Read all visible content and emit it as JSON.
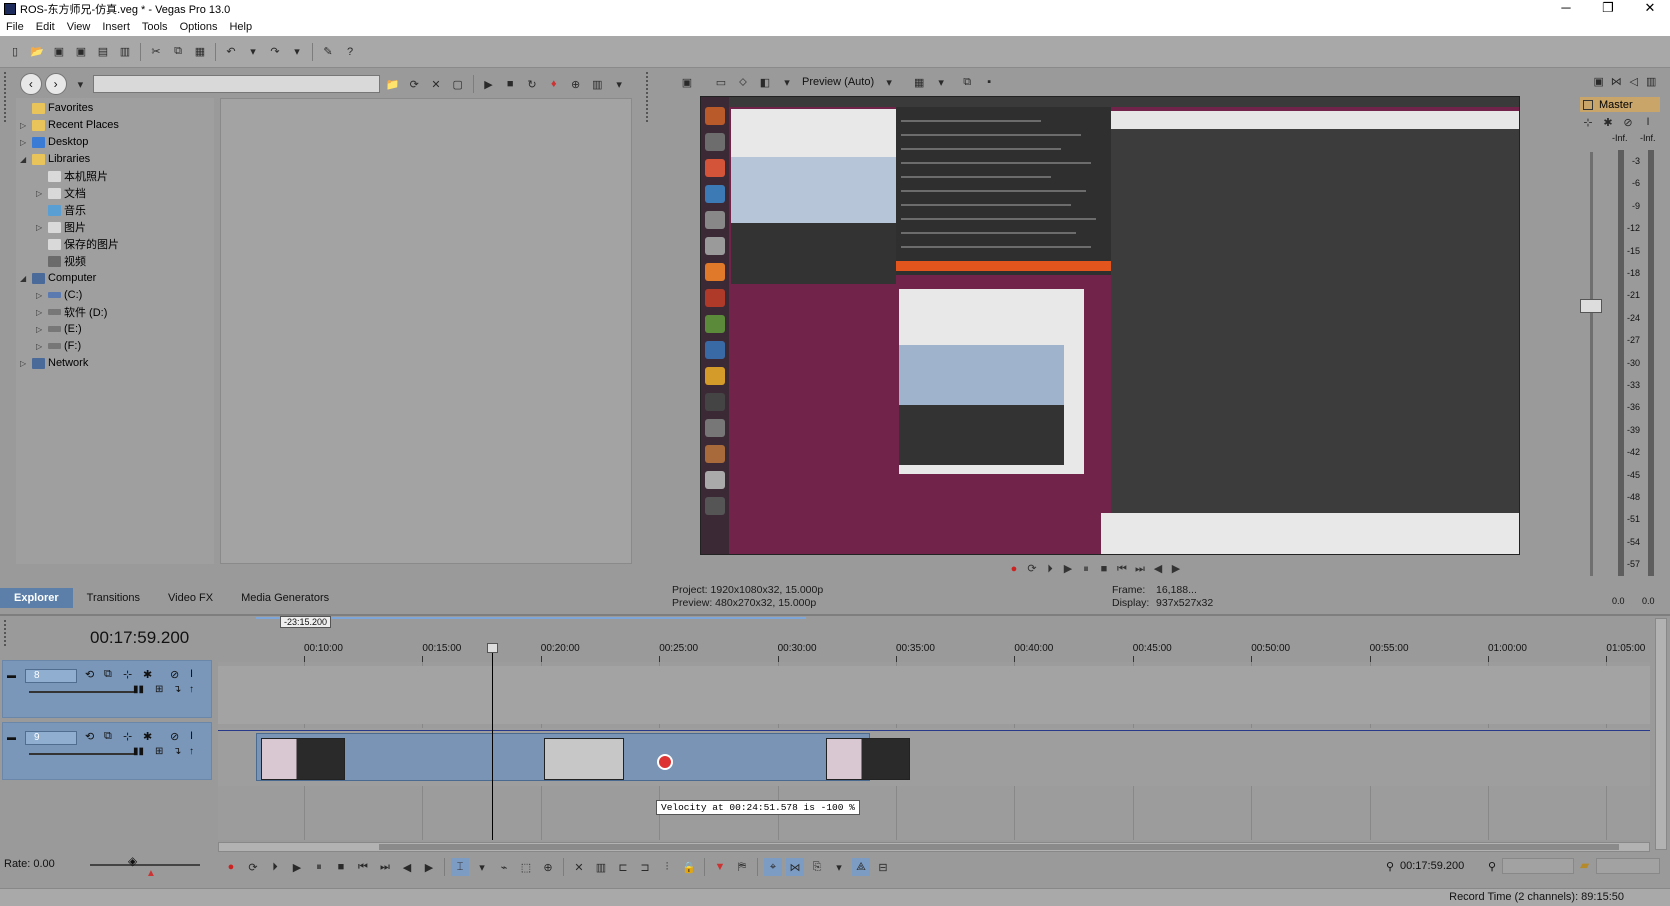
{
  "window": {
    "title": "ROS-东方师兄-仿真.veg * - Vegas Pro 13.0",
    "minimize": "─",
    "restore": "❐",
    "close": "✕"
  },
  "menu": [
    "File",
    "Edit",
    "View",
    "Insert",
    "Tools",
    "Options",
    "Help"
  ],
  "explorer": {
    "tree": [
      {
        "label": "Favorites",
        "expander": "",
        "icon_color": "#e8c45a"
      },
      {
        "label": "Recent Places",
        "expander": "▷",
        "icon_color": "#e8c45a"
      },
      {
        "label": "Desktop",
        "expander": "▷",
        "icon_color": "#3a7bd5"
      },
      {
        "label": "Libraries",
        "expander": "◢",
        "icon_color": "#e8c45a"
      },
      {
        "label": "本机照片",
        "expander": "",
        "icon_color": "#d9d9d9"
      },
      {
        "label": "文档",
        "expander": "▷",
        "icon_color": "#d9d9d9"
      },
      {
        "label": "音乐",
        "expander": "",
        "icon_color": "#5a9fd4"
      },
      {
        "label": "图片",
        "expander": "▷",
        "icon_color": "#d9d9d9"
      },
      {
        "label": "保存的图片",
        "expander": "",
        "icon_color": "#d9d9d9"
      },
      {
        "label": "视频",
        "expander": "",
        "icon_color": "#6b6b6b"
      },
      {
        "label": "Computer",
        "expander": "◢",
        "icon_color": "#4a6a9a"
      },
      {
        "label": "(C:)",
        "expander": "▷",
        "icon_color": "#5a7ab0"
      },
      {
        "label": "软件 (D:)",
        "expander": "▷",
        "icon_color": "#777777"
      },
      {
        "label": "(E:)",
        "expander": "▷",
        "icon_color": "#777777"
      },
      {
        "label": "(F:)",
        "expander": "▷",
        "icon_color": "#777777"
      },
      {
        "label": "Network",
        "expander": "▷",
        "icon_color": "#4a6a9a"
      }
    ],
    "tabs": [
      "Explorer",
      "Transitions",
      "Video FX",
      "Media Generators"
    ]
  },
  "preview": {
    "mode": "Preview (Auto)",
    "project": "Project:  1920x1080x32, 15.000p",
    "preview": "Preview: 480x270x32, 15.000p",
    "frame_label": "Frame:",
    "frame_value": "16,188...",
    "display_label": "Display:",
    "display_value": "937x527x32"
  },
  "master": {
    "title": "Master",
    "inf_left": "-Inf.",
    "inf_right": "-Inf.",
    "scale": [
      "3",
      "6",
      "9",
      "12",
      "15",
      "18",
      "21",
      "24",
      "27",
      "30",
      "33",
      "36",
      "39",
      "42",
      "45",
      "48",
      "51",
      "54",
      "57"
    ],
    "bottom_left": "0.0",
    "bottom_right": "0.0"
  },
  "timeline": {
    "timecode": "00:17:59.200",
    "loop_marker": "-23:15.200",
    "ruler": [
      "00:10:00",
      "00:15:00",
      "00:20:00",
      "00:25:00",
      "00:30:00",
      "00:35:00",
      "00:40:00",
      "00:45:00",
      "00:50:00",
      "00:55:00",
      "01:00:00",
      "01:05:00"
    ],
    "tracks": [
      {
        "number": "8"
      },
      {
        "number": "9"
      }
    ],
    "tooltip": "Velocity at 00:24:51.578 is -100 %",
    "rate": "Rate: 0.00",
    "cursor_time": "00:17:59.200"
  },
  "status": {
    "record_time": "Record Time (2 channels): 89:15:50"
  }
}
